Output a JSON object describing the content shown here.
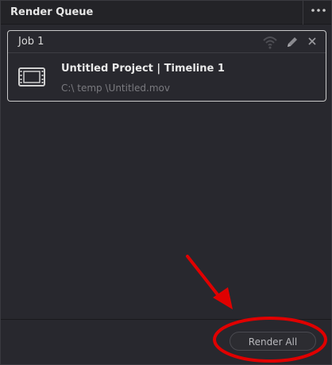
{
  "panel": {
    "title": "Render Queue",
    "menu_icon": "more-options-icon"
  },
  "job": {
    "header": "Job 1",
    "name": "Untitled Project | Timeline 1",
    "path": "C:\\ temp \\Untitled.mov",
    "icons": [
      "remote-render-icon",
      "edit-pencil-icon",
      "close-icon",
      "film-clip-icon"
    ]
  },
  "footer": {
    "render_all_label": "Render All"
  },
  "colors": {
    "background": "#28282e",
    "titlebar": "#232327",
    "annotation": "#e00000",
    "card_border": "#c9c9c9"
  }
}
